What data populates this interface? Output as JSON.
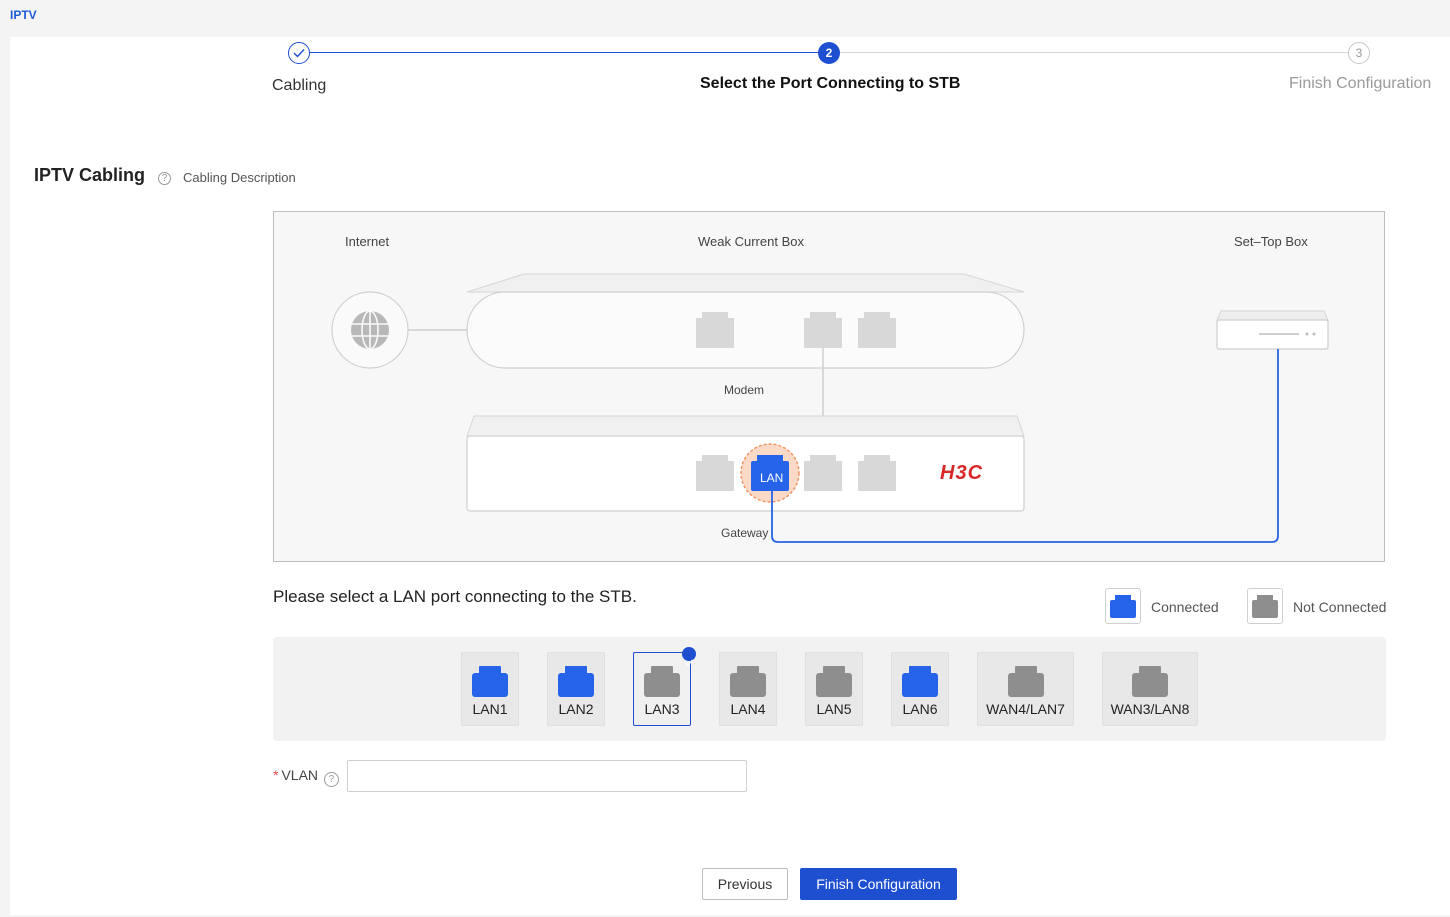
{
  "page": {
    "tab_title": "IPTV"
  },
  "steps": [
    {
      "label": "Cabling",
      "number": "1",
      "state": "done"
    },
    {
      "label": "Select the Port Connecting to STB",
      "number": "2",
      "state": "active"
    },
    {
      "label": "Finish Configuration",
      "number": "3",
      "state": "pending"
    }
  ],
  "section": {
    "title": "IPTV Cabling",
    "help_link": "Cabling Description"
  },
  "diagram": {
    "internet_label": "Internet",
    "weak_box_label": "Weak Current Box",
    "stb_label": "Set–Top Box",
    "modem_label": "Modem",
    "gateway_label": "Gateway",
    "lan_tag": "LAN",
    "brand": "H3C"
  },
  "instruction": "Please select a LAN port connecting to the STB.",
  "legend": {
    "connected": "Connected",
    "not_connected": "Not Connected"
  },
  "ports": [
    {
      "label": "LAN1",
      "status": "connected",
      "selected": false
    },
    {
      "label": "LAN2",
      "status": "connected",
      "selected": false
    },
    {
      "label": "LAN3",
      "status": "not_connected",
      "selected": true
    },
    {
      "label": "LAN4",
      "status": "not_connected",
      "selected": false
    },
    {
      "label": "LAN5",
      "status": "not_connected",
      "selected": false
    },
    {
      "label": "LAN6",
      "status": "connected",
      "selected": false
    },
    {
      "label": "WAN4/LAN7",
      "status": "not_connected",
      "selected": false
    },
    {
      "label": "WAN3/LAN8",
      "status": "not_connected",
      "selected": false
    }
  ],
  "vlan": {
    "label": "VLAN",
    "required_mark": "*",
    "value": ""
  },
  "buttons": {
    "previous": "Previous",
    "finish": "Finish Configuration"
  },
  "colors": {
    "primary": "#1f4fd1",
    "connected": "#2563e8",
    "not_connected": "#8e8e8e",
    "pending": "#9a9a9a",
    "required": "#e24b4b",
    "brand_red": "#d92626"
  }
}
